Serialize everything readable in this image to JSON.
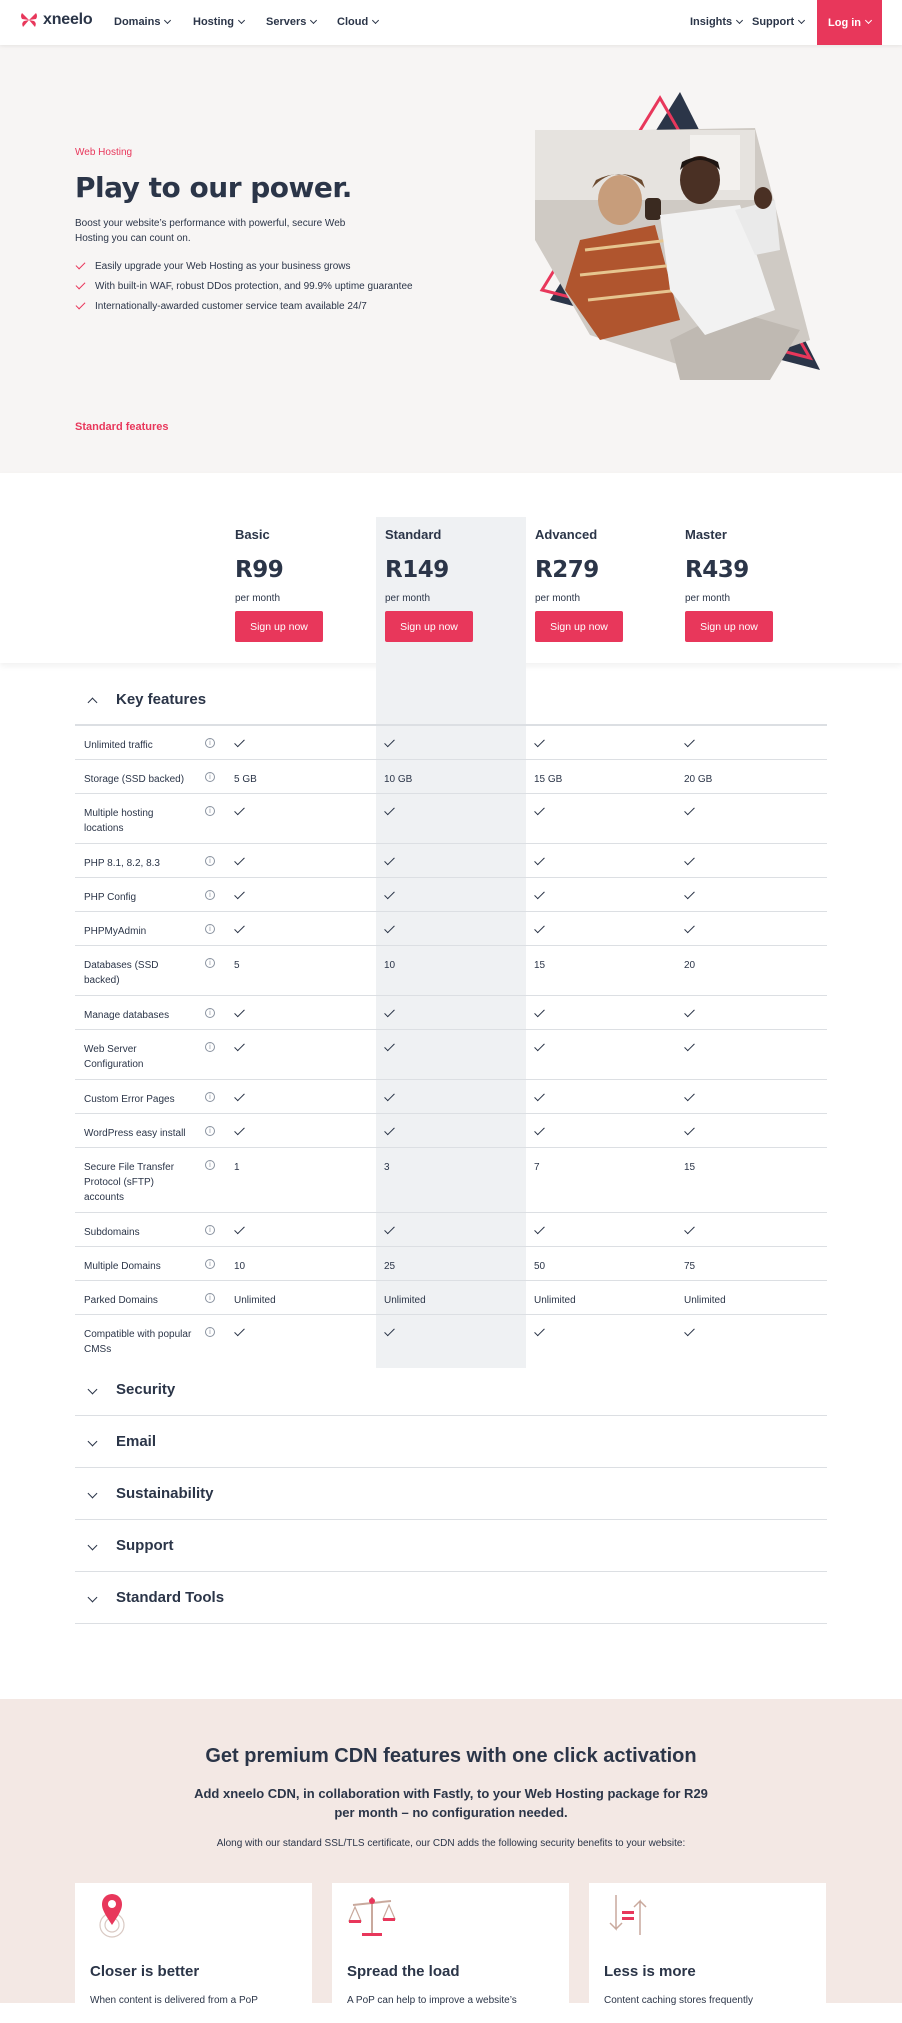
{
  "nav": {
    "brand": "xneelo",
    "items": [
      "Domains",
      "Hosting",
      "Servers",
      "Cloud"
    ],
    "right_items": [
      "Insights",
      "Support"
    ],
    "login": "Log in"
  },
  "hero": {
    "eyebrow": "Web Hosting",
    "title": "Play to our power.",
    "description": "Boost your website’s performance with powerful, secure Web Hosting you can count on.",
    "bullets": [
      "Easily upgrade your Web Hosting as your business grows",
      "With built-in WAF, robust DDos protection, and 99.9% uptime guarantee",
      "Internationally-awarded customer service team available 24/7"
    ],
    "link": "Standard features"
  },
  "plans": [
    {
      "name": "Basic",
      "price": "R99",
      "period": "per month",
      "cta": "Sign up now"
    },
    {
      "name": "Standard",
      "price": "R149",
      "period": "per month",
      "cta": "Sign up now"
    },
    {
      "name": "Advanced",
      "price": "R279",
      "period": "per month",
      "cta": "Sign up now"
    },
    {
      "name": "Master",
      "price": "R439",
      "period": "per month",
      "cta": "Sign up now"
    }
  ],
  "key_features": {
    "title": "Key features",
    "rows": [
      {
        "name": "Unlimited traffic",
        "values": [
          "check",
          "check",
          "check",
          "check"
        ]
      },
      {
        "name": "Storage (SSD backed)",
        "values": [
          "5 GB",
          "10 GB",
          "15 GB",
          "20 GB"
        ]
      },
      {
        "name": "Multiple hosting locations",
        "values": [
          "check",
          "check",
          "check",
          "check"
        ]
      },
      {
        "name": "PHP 8.1, 8.2, 8.3",
        "values": [
          "check",
          "check",
          "check",
          "check"
        ]
      },
      {
        "name": "PHP Config",
        "values": [
          "check",
          "check",
          "check",
          "check"
        ]
      },
      {
        "name": "PHPMyAdmin",
        "values": [
          "check",
          "check",
          "check",
          "check"
        ]
      },
      {
        "name": "Databases (SSD backed)",
        "values": [
          "5",
          "10",
          "15",
          "20"
        ]
      },
      {
        "name": "Manage databases",
        "values": [
          "check",
          "check",
          "check",
          "check"
        ]
      },
      {
        "name": "Web Server Configuration",
        "values": [
          "check",
          "check",
          "check",
          "check"
        ]
      },
      {
        "name": "Custom Error Pages",
        "values": [
          "check",
          "check",
          "check",
          "check"
        ]
      },
      {
        "name": "WordPress easy install",
        "values": [
          "check",
          "check",
          "check",
          "check"
        ]
      },
      {
        "name": "Secure File Transfer Protocol (sFTP) accounts",
        "values": [
          "1",
          "3",
          "7",
          "15"
        ]
      },
      {
        "name": "Subdomains",
        "values": [
          "check",
          "check",
          "check",
          "check"
        ]
      },
      {
        "name": "Multiple Domains",
        "values": [
          "10",
          "25",
          "50",
          "75"
        ]
      },
      {
        "name": "Parked Domains",
        "values": [
          "Unlimited",
          "Unlimited",
          "Unlimited",
          "Unlimited"
        ]
      },
      {
        "name": "Compatible with popular CMSs",
        "values": [
          "check",
          "check",
          "check",
          "check"
        ]
      }
    ]
  },
  "sections": [
    "Security",
    "Email",
    "Sustainability",
    "Support",
    "Standard Tools"
  ],
  "cdn": {
    "title": "Get premium CDN features with one click activation",
    "subtitle": "Add xneelo CDN, in collaboration with Fastly, to your Web Hosting package for R29 per month – no configuration needed.",
    "note": "Along with our standard SSL/TLS certificate, our CDN adds the following security benefits to your website:",
    "cards": [
      {
        "title": "Closer is better",
        "text": "When content is delivered from a PoP",
        "icon": "location-pin-icon"
      },
      {
        "title": "Spread the load",
        "text": "A PoP can help to improve a website’s",
        "icon": "scales-icon"
      },
      {
        "title": "Less is more",
        "text": "Content caching stores frequently",
        "icon": "arrows-icon"
      }
    ]
  },
  "colors": {
    "accent": "#e8375b",
    "text": "#2b3548",
    "hero_bg": "#f7f5f4",
    "cdn_bg": "#f3e8e4",
    "highlight_col": "#eff1f3"
  }
}
